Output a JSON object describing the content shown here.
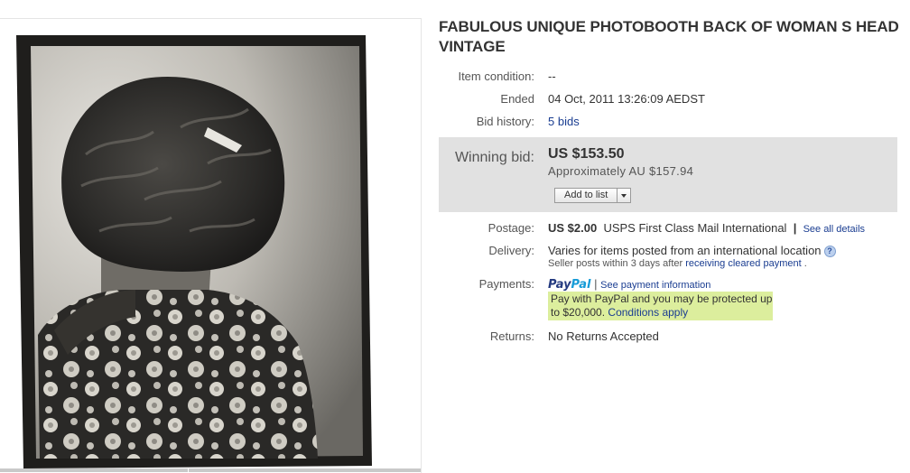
{
  "listing": {
    "title": "FABULOUS UNIQUE PHOTOBOOTH BACK OF WOMAN S HEAD VINTAGE",
    "image_alt": "Vintage photobooth photo of the back of a woman's head"
  },
  "details": {
    "item_condition": {
      "label": "Item condition:",
      "value": "--"
    },
    "ended": {
      "label": "Ended",
      "value": "04 Oct, 2011 13:26:09 AEDST"
    },
    "bid_history": {
      "label": "Bid history:",
      "value": "5 bids"
    }
  },
  "bid": {
    "label": "Winning bid:",
    "amount": "US $153.50",
    "approx": "Approximately AU $157.94",
    "add_to_list": "Add to list"
  },
  "postage": {
    "label": "Postage:",
    "cost": "US $2.00",
    "service": "USPS First Class Mail International",
    "separator": "|",
    "link": "See all details"
  },
  "delivery": {
    "label": "Delivery:",
    "value": "Varies for items posted from an international location",
    "note_prefix": "Seller posts within 3 days after",
    "note_link": "receiving cleared payment",
    "note_suffix": "."
  },
  "payments": {
    "label": "Payments:",
    "logo_pay": "Pay",
    "logo_pal": "Pal",
    "separator": "|",
    "link": "See payment information",
    "protection_text": "Pay with PayPal and you may be protected up to $20,000.",
    "protection_link": "Conditions apply"
  },
  "returns": {
    "label": "Returns:",
    "value": "No Returns Accepted"
  },
  "colors": {
    "link": "#1a3d91",
    "bid_box": "#e1e1e1",
    "paypal_highlight": "#dcee9d"
  }
}
